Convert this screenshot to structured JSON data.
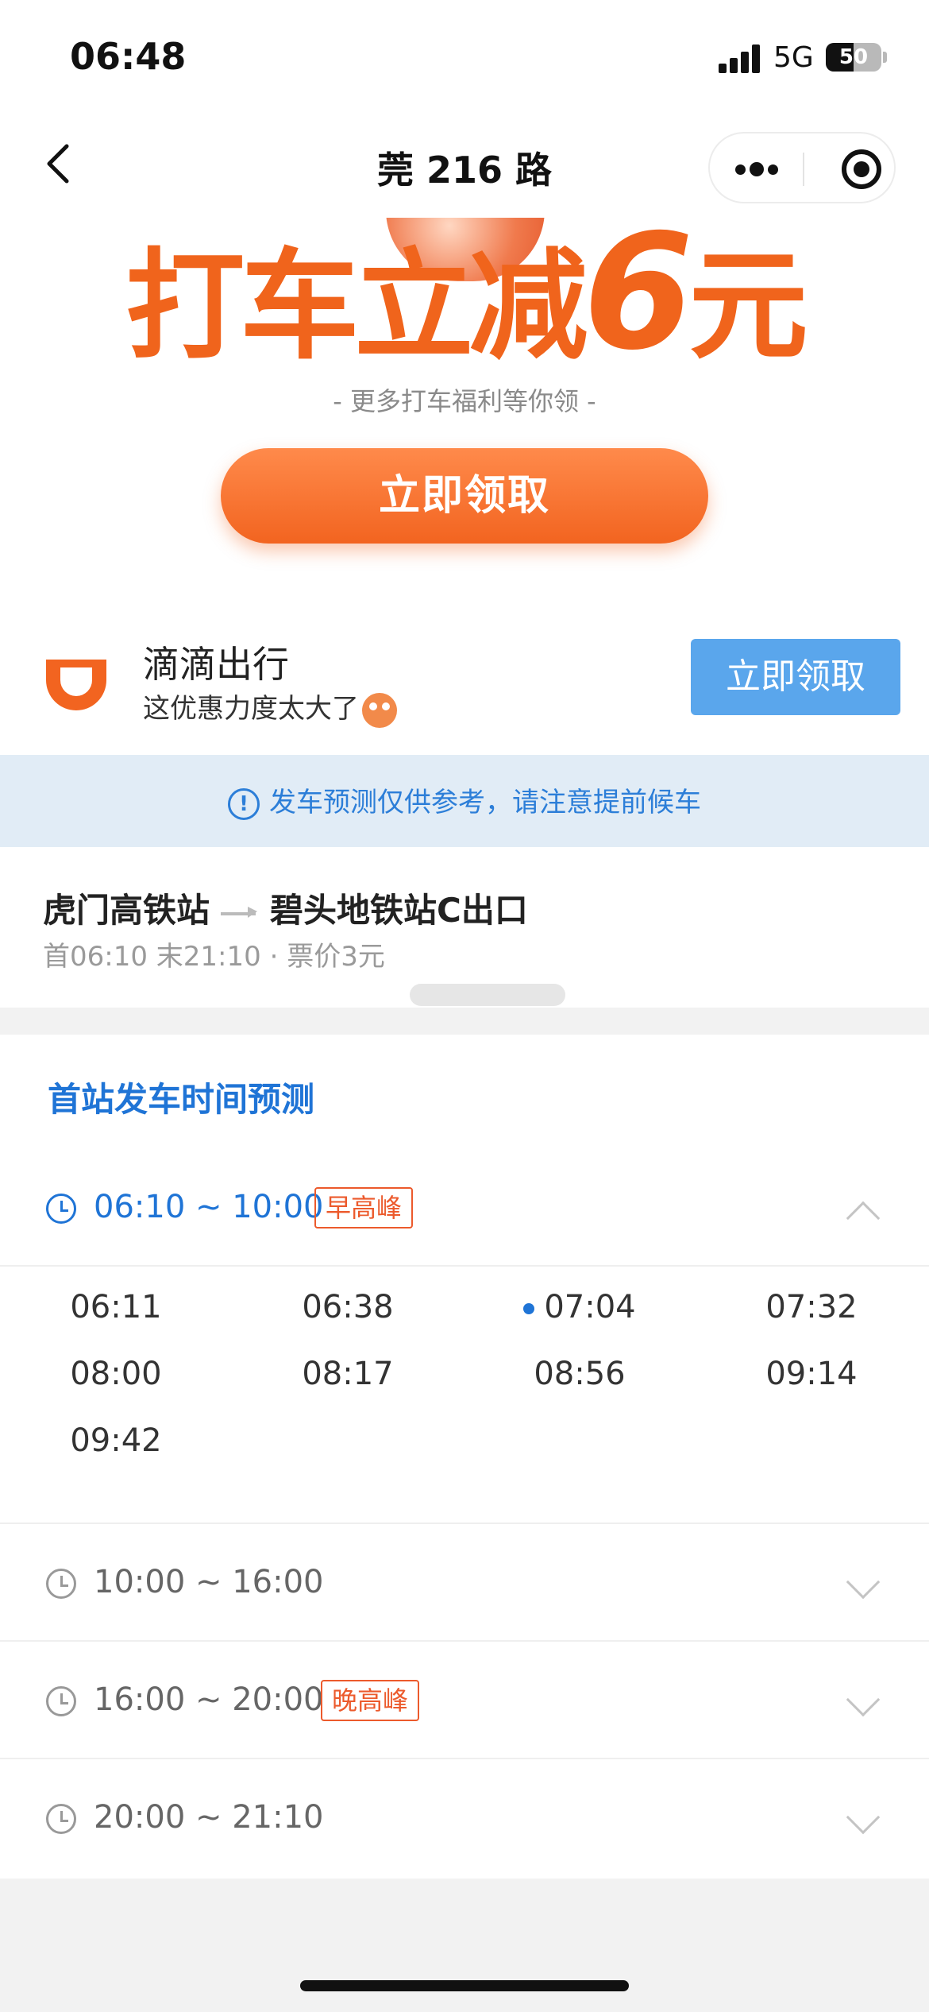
{
  "status_bar": {
    "time": "06:48",
    "network": "5G",
    "battery": "50",
    "battery_level": 0.5
  },
  "nav": {
    "title": "莞 216 路"
  },
  "banner": {
    "title_main": "打车立减",
    "title_number": "6",
    "title_unit": "元",
    "subtitle": "- 更多打车福利等你领 -",
    "button": "立即领取"
  },
  "ad": {
    "name": "滴滴出行",
    "desc": "这优惠力度太大了",
    "button": "立即领取",
    "brand_color": "#f26420"
  },
  "notice": {
    "icon": "!",
    "text": "发车预测仅供参考，请注意提前候车"
  },
  "route": {
    "from": "虎门高铁站",
    "to": "碧头地铁站C出口",
    "info": "首06:10 末21:10 · 票价3元"
  },
  "schedule": {
    "title": "首站发车时间预测",
    "periods": [
      {
        "range": "06:10 ~ 10:00",
        "tag": "早高峰",
        "expanded": true,
        "times": [
          "06:11",
          "06:38",
          "07:04",
          "07:32",
          "08:00",
          "08:17",
          "08:56",
          "09:14",
          "09:42"
        ],
        "highlight": "07:04"
      },
      {
        "range": "10:00 ~ 16:00",
        "tag": "",
        "expanded": false
      },
      {
        "range": "16:00 ~ 20:00",
        "tag": "晚高峰",
        "expanded": false
      },
      {
        "range": "20:00 ~ 21:10",
        "tag": "",
        "expanded": false
      }
    ]
  },
  "colors": {
    "accent": "#1f74d6",
    "promo": "#f0641c",
    "tag": "#ec5a2c"
  }
}
